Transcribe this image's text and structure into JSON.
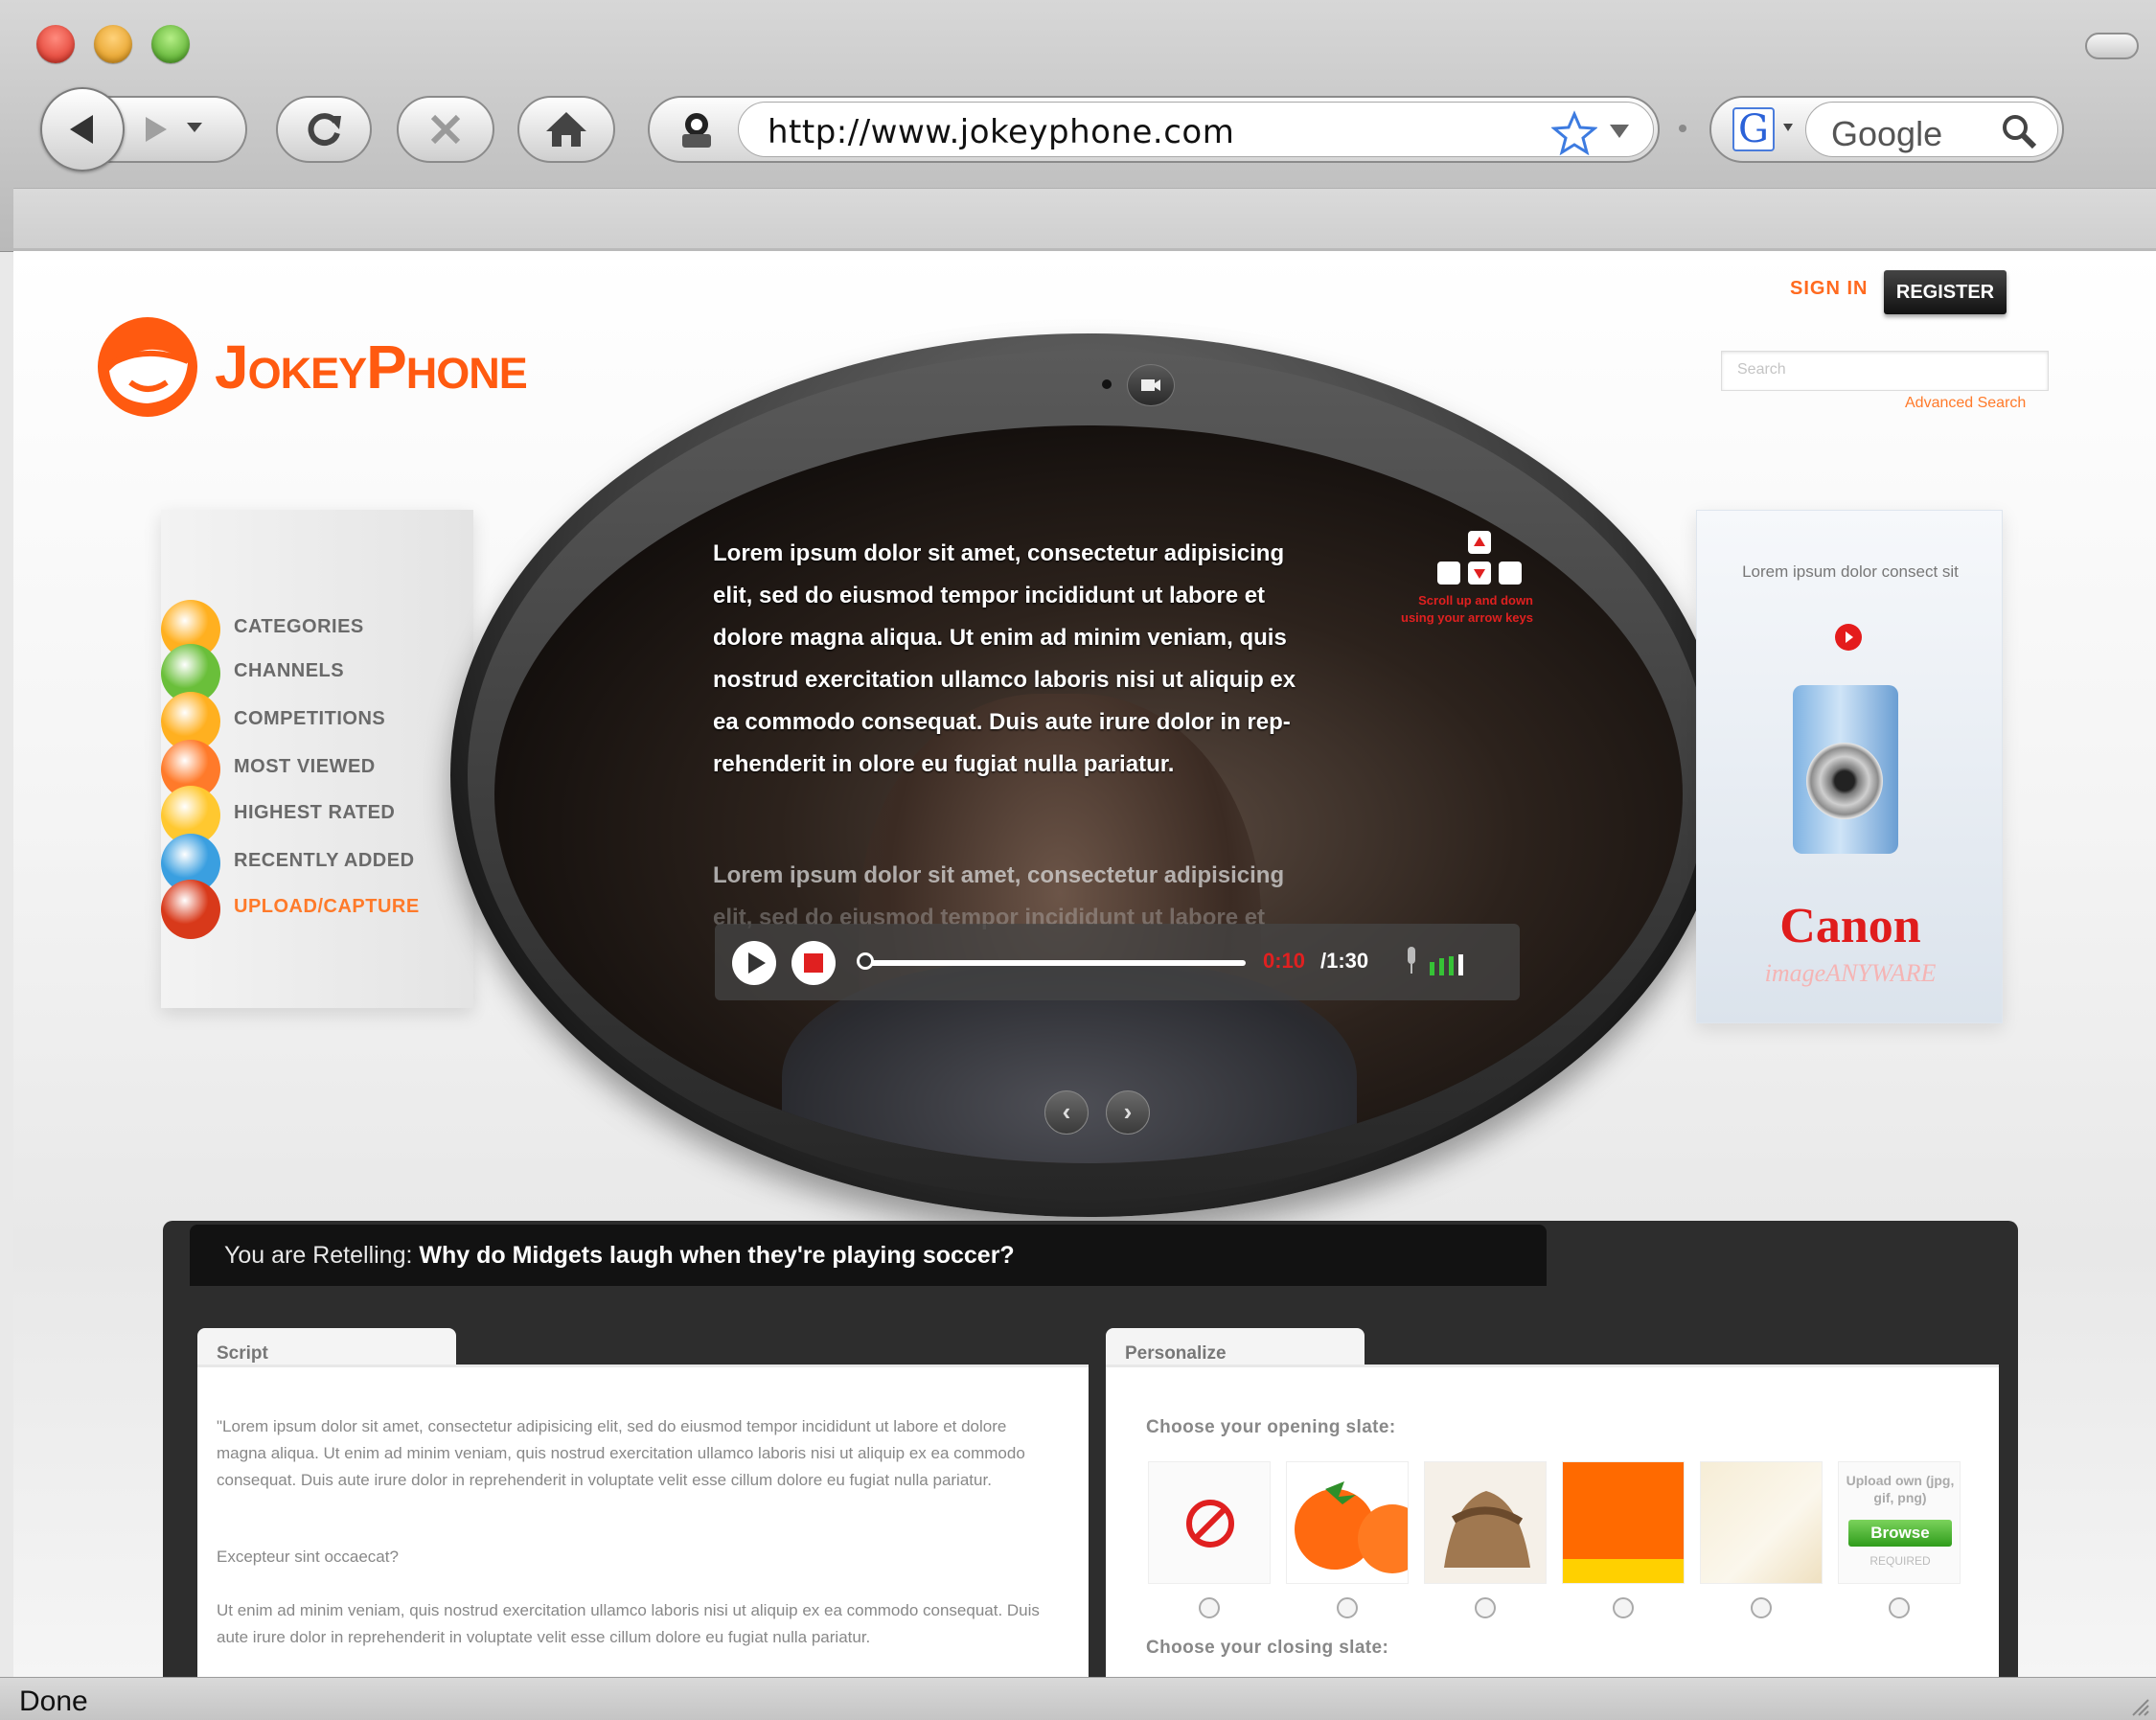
{
  "browser": {
    "url": "http://www.jokeyphone.com",
    "search_placeholder": "Google",
    "google_letter": "G",
    "status": "Done"
  },
  "site": {
    "logo": "JokeyPhone",
    "signin": "SIGN IN",
    "register": "REGISTER",
    "search_placeholder": "Search",
    "advanced_search": "Advanced Search"
  },
  "menu": [
    {
      "label": "Categories",
      "icon": "categories-icon",
      "color": "#ffb020"
    },
    {
      "label": "Channels",
      "icon": "channels-icon",
      "color": "#6abf3a"
    },
    {
      "label": "Competitions",
      "icon": "competitions-icon",
      "color": "#ffb020"
    },
    {
      "label": "Most Viewed",
      "icon": "most-viewed-icon",
      "color": "#ff7a2a"
    },
    {
      "label": "Highest Rated",
      "icon": "highest-rated-icon",
      "color": "#ffc830"
    },
    {
      "label": "Recently Added",
      "icon": "recently-added-icon",
      "color": "#3a9fe0"
    },
    {
      "label": "Upload/Capture",
      "icon": "upload-capture-icon",
      "color": "#d8391a"
    }
  ],
  "video": {
    "text1": "Lorem ipsum dolor sit amet, consectetur adipisicing elit, sed do eiusmod tempor incididunt ut labore et dolore magna aliqua. Ut enim ad minim veniam, quis nostrud exercitation ullamco laboris nisi ut aliquip ex ea commodo consequat. Duis aute irure dolor in rep-rehenderit in olore eu fugiat nulla pariatur.",
    "text2": "Lorem ipsum dolor sit amet, consectetur adipisicing",
    "text3": "elit, sed do eiusmod tempor incididunt ut labore et",
    "keypad_note": "Scroll up and down using your arrow keys",
    "time_current": "0:10",
    "time_total": "/1:30",
    "progress": 0.0
  },
  "ad": {
    "text": "Lorem ipsum dolor consect sit",
    "brand": "Canon",
    "tagline": "imageANYWARE"
  },
  "retell": {
    "prefix": "You are Retelling:",
    "question": "Why do Midgets laugh when they're playing soccer?"
  },
  "script": {
    "tab": "Script",
    "p1": "\"Lorem ipsum dolor sit amet, consectetur adipisicing elit, sed do eiusmod tempor incididunt ut labore et dolore magna aliqua. Ut enim ad minim veniam, quis nostrud exercitation ullamco laboris nisi ut aliquip ex ea commodo consequat. Duis aute irure dolor in reprehenderit in voluptate velit esse cillum dolore eu fugiat nulla pariatur.",
    "p2": "Excepteur sint occaecat?",
    "p3": "Ut enim ad minim veniam, quis nostrud exercitation ullamco laboris nisi ut aliquip ex ea commodo consequat. Duis aute irure dolor in reprehenderit in voluptate velit esse cillum dolore eu fugiat nulla pariatur."
  },
  "personalize": {
    "tab": "Personalize",
    "opening_label": "Choose your opening slate:",
    "closing_label": "Choose your closing slate:",
    "upload_text": "Upload own (jpg, gif, png)",
    "browse": "Browse",
    "upload_sub": "REQUIRED"
  },
  "colors": {
    "brand_orange": "#ff5a10",
    "accent_red": "#e02020",
    "browse_green": "#2f9c1b"
  }
}
